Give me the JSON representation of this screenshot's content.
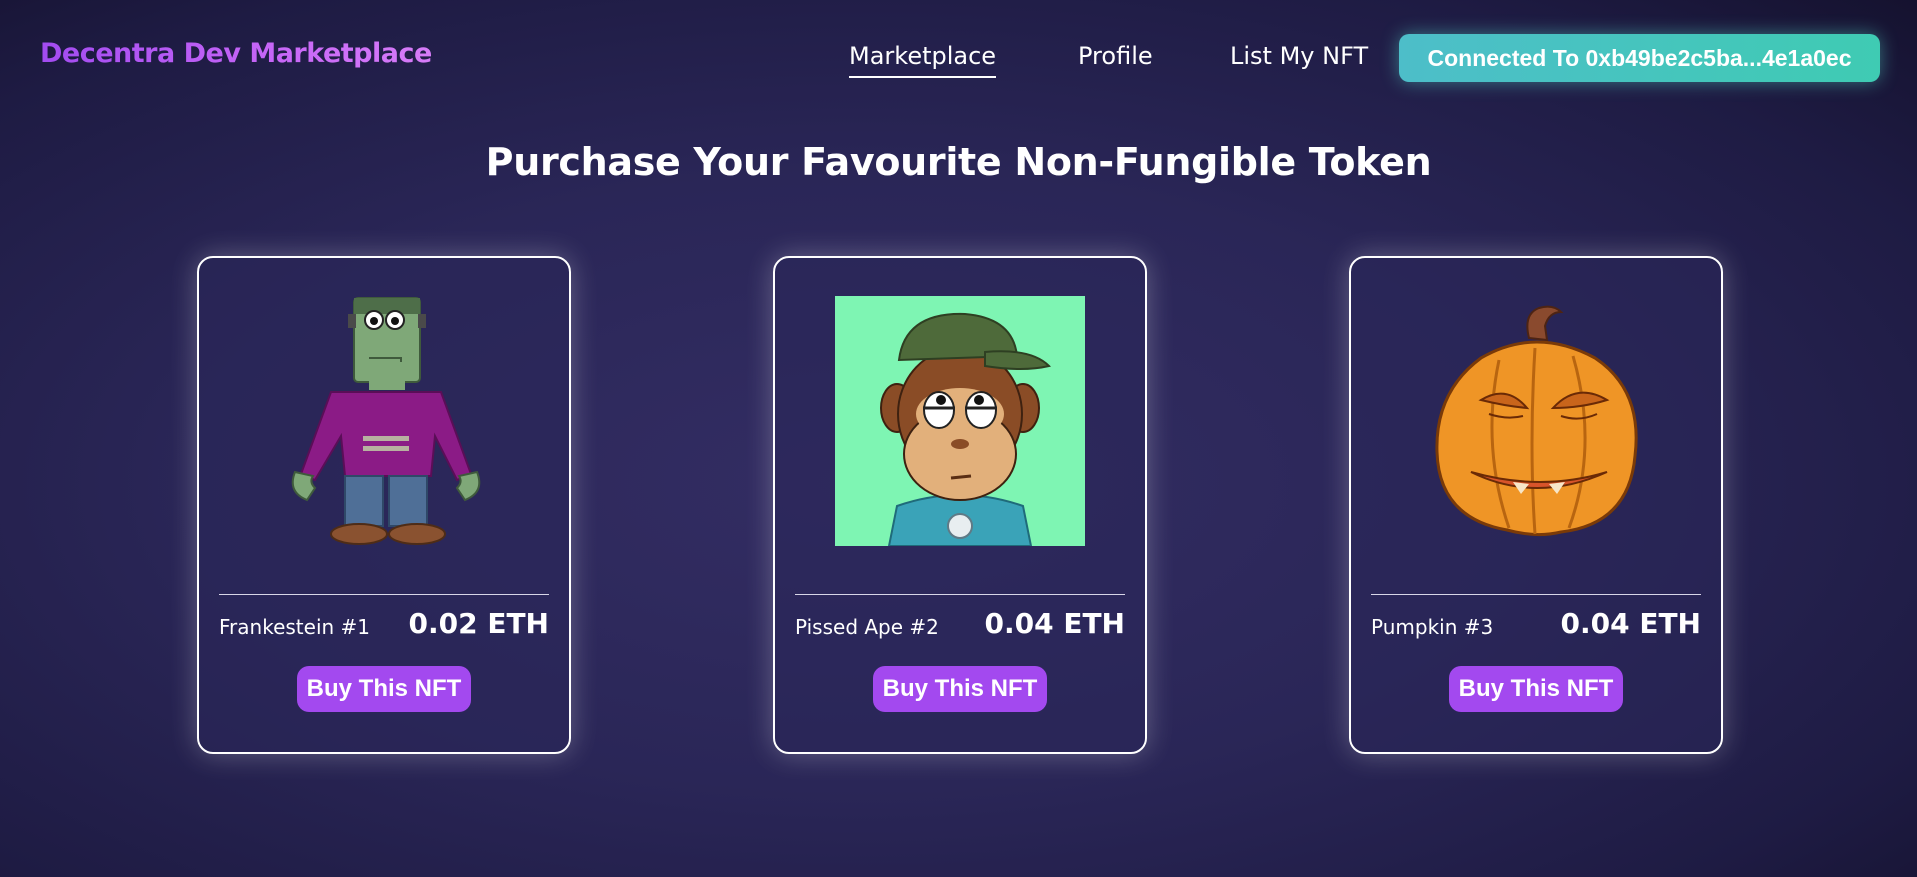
{
  "brand": {
    "title": "Decentra Dev Marketplace"
  },
  "nav": {
    "items": [
      {
        "label": "Marketplace",
        "active": true
      },
      {
        "label": "Profile",
        "active": false
      },
      {
        "label": "List My NFT",
        "active": false
      }
    ],
    "wallet_button": "Connected To 0xb49be2c5ba...4e1a0ec"
  },
  "main": {
    "heading": "Purchase Your Favourite Non-Fungible Token",
    "cards": [
      {
        "name": "Frankestein #1",
        "price": "0.02 ETH",
        "button": "Buy This NFT",
        "image": "frankenstein-character"
      },
      {
        "name": "Pissed Ape #2",
        "price": "0.04 ETH",
        "button": "Buy This NFT",
        "image": "ape-in-cap"
      },
      {
        "name": "Pumpkin #3",
        "price": "0.04 ETH",
        "button": "Buy This NFT",
        "image": "pumpkin-face"
      }
    ]
  },
  "colors": {
    "brand_gradient": [
      "#a24bf0",
      "#d77cf8"
    ],
    "wallet_button": "#45c6bd",
    "buy_button": "#a349ef",
    "background": "#2a2657"
  }
}
